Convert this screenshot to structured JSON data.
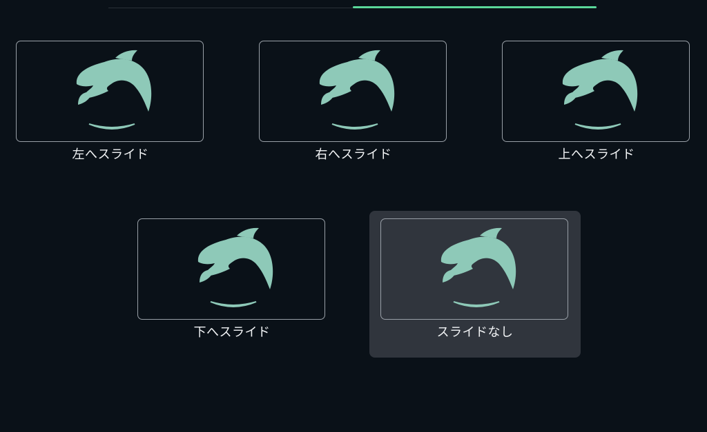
{
  "progress": {
    "fraction": 0.5,
    "accent_color": "#5ad79a",
    "track_color": "#2a3138"
  },
  "icon": {
    "name": "dolphin-icon",
    "color": "#8ec9b8"
  },
  "options": [
    {
      "label": "左へスライド",
      "selected": false
    },
    {
      "label": "右へスライド",
      "selected": false
    },
    {
      "label": "上へスライド",
      "selected": false
    },
    {
      "label": "下へスライド",
      "selected": false
    },
    {
      "label": "スライドなし",
      "selected": true
    }
  ]
}
